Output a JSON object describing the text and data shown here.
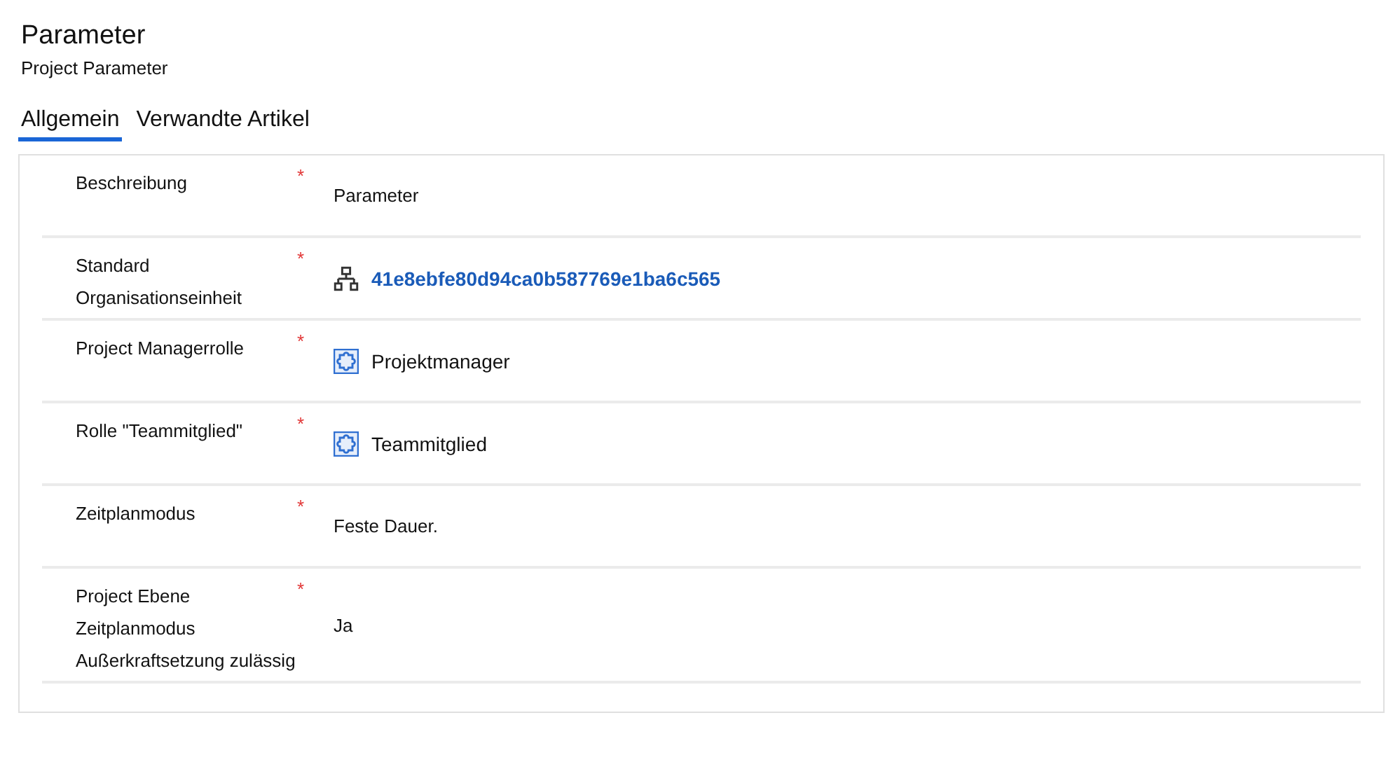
{
  "header": {
    "title": "Parameter",
    "subtitle": "Project Parameter"
  },
  "tabs": [
    {
      "label": "Allgemein",
      "selected": true
    },
    {
      "label": "Verwandte Artikel",
      "selected": false
    }
  ],
  "fields": [
    {
      "label_lines": [
        "Beschreibung"
      ],
      "required_mark": "*",
      "kind": "text",
      "value": "Parameter"
    },
    {
      "label_lines": [
        "Standard",
        "Organisationseinheit"
      ],
      "required_mark": "*",
      "kind": "link",
      "value": "41e8ebfe80d94ca0b587769e1ba6c565"
    },
    {
      "label_lines": [
        "Project Managerrolle"
      ],
      "required_mark": "*",
      "kind": "role",
      "value": "Projektmanager"
    },
    {
      "label_lines": [
        "Rolle \"Teammitglied\""
      ],
      "required_mark": "*",
      "kind": "role",
      "value": "Teammitglied"
    },
    {
      "label_lines": [
        "Zeitplanmodus"
      ],
      "required_mark": "*",
      "kind": "text",
      "value": "Feste Dauer."
    },
    {
      "label_lines": [
        "Project Ebene",
        "Zeitplanmodus",
        "Außerkraftsetzung zulässig"
      ],
      "required_mark": "*",
      "kind": "text",
      "value": "Ja"
    }
  ]
}
